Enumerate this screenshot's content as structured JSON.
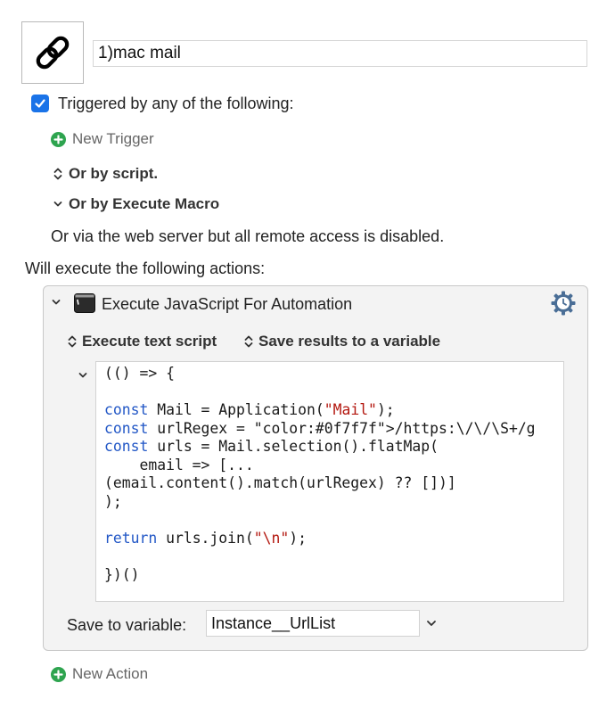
{
  "macro": {
    "name": "1)mac mail",
    "icon": "link-icon"
  },
  "triggers": {
    "checkbox_checked": true,
    "label": "Triggered by any of the following:",
    "new_trigger": "New Trigger",
    "by_script": "Or by script.",
    "by_execute_macro": "Or by Execute Macro",
    "web_server_note": "Or via the web server but all remote access is disabled."
  },
  "actions": {
    "label": "Will execute the following actions:",
    "action": {
      "title": "Execute JavaScript For Automation",
      "icon": "terminal-icon",
      "mode_label": "Execute text script",
      "result_label": "Save results to a variable",
      "code_lines": [
        "(() => {",
        "",
        "const Mail = Application(\"Mail\");",
        "const urlRegex = /https:\\/\\/\\S+/g",
        "const urls = Mail.selection().flatMap(",
        "    email => [...",
        "(email.content().match(urlRegex) ?? [])]",
        ");",
        "",
        "return urls.join(\"\\n\");",
        "",
        "})()"
      ],
      "save_to_label": "Save to variable:",
      "variable": "Instance__UrlList"
    },
    "new_action": "New Action"
  },
  "colors": {
    "accent": "#1a73e8",
    "add_green": "#2ea44f",
    "keyword": "#2257c6",
    "string": "#b3170f",
    "regex": "#0f7f7f"
  }
}
